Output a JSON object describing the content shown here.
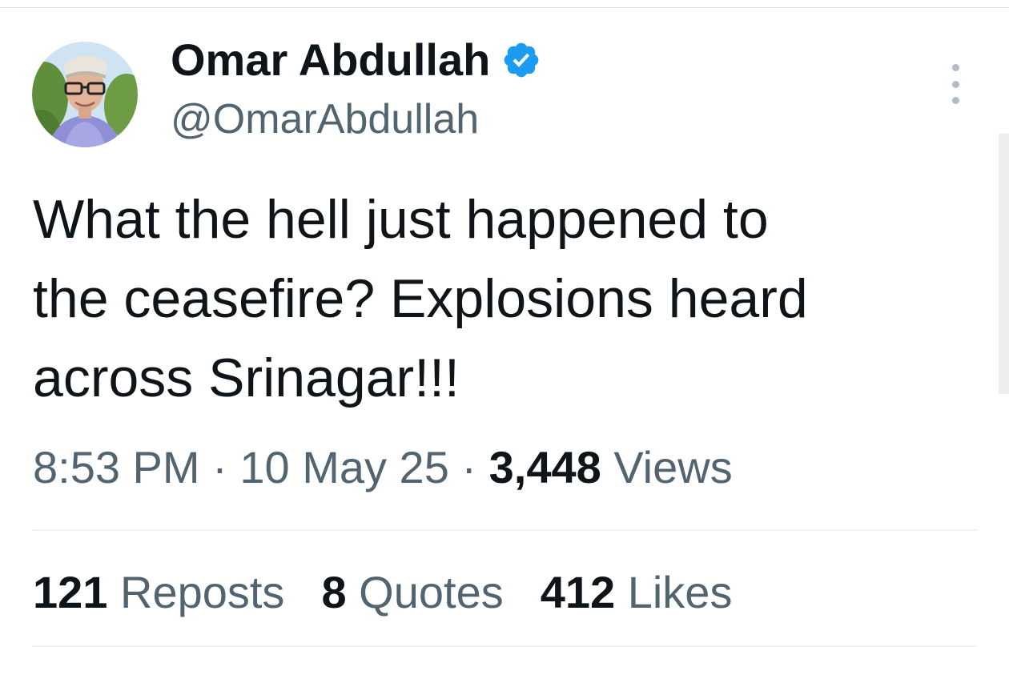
{
  "tweet": {
    "author": {
      "display_name": "Omar Abdullah",
      "handle": "@OmarAbdullah",
      "verified": true
    },
    "text": "What the hell just happened to\nthe ceasefire? Explosions heard\nacross Srinagar!!!",
    "time": "8:53 PM",
    "separator": "·",
    "date": "10 May 25",
    "views_count": "3,448",
    "views_label": "Views"
  },
  "stats": {
    "reposts": {
      "count": "121",
      "label": "Reposts"
    },
    "quotes": {
      "count": "8",
      "label": "Quotes"
    },
    "likes": {
      "count": "412",
      "label": "Likes"
    }
  },
  "colors": {
    "text_primary": "#0f1419",
    "text_secondary": "#536471",
    "verified_blue": "#1d9bf0",
    "divider": "#eff3f4"
  },
  "icons": {
    "verified": "verified-badge-icon",
    "more": "more-vertical-icon"
  }
}
